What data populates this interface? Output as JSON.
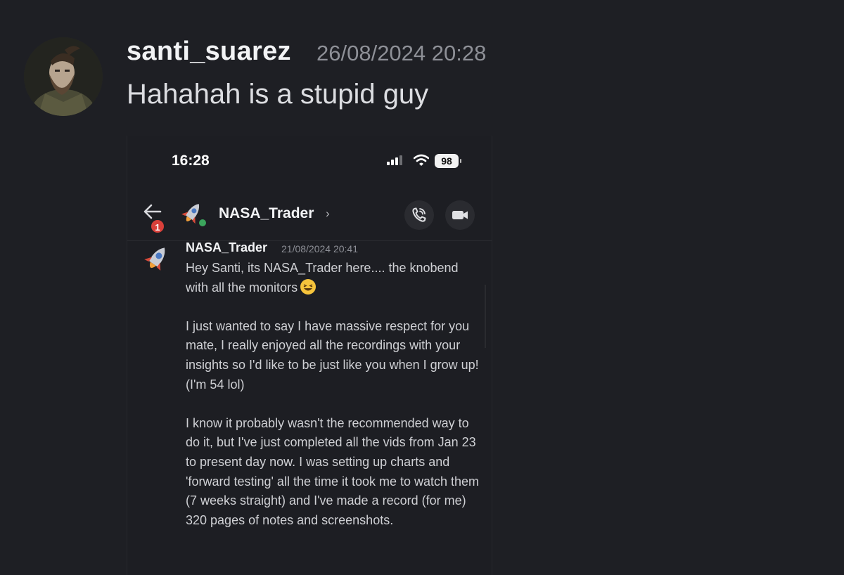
{
  "message": {
    "author": "santi_suarez",
    "timestamp": "26/08/2024 20:28",
    "text": "Hahahah is a stupid guy"
  },
  "screenshot": {
    "status_bar": {
      "time": "16:28",
      "battery": "98"
    },
    "header": {
      "notification_count": "1",
      "name": "NASA_Trader",
      "chevron": "›"
    },
    "dm": {
      "author": "NASA_Trader",
      "timestamp": "21/08/2024 20:41",
      "paragraphs": [
        "Hey Santi, its NASA_Trader here.... the knobend with all the monitors",
        "I just wanted to say I have massive respect for you mate, I really enjoyed all the recordings with your insights so I'd like to be just like you when I grow up! (I'm 54 lol)",
        "I know it probably wasn't the recommended way to do it, but I've just completed all the vids from Jan 23 to present day now. I was setting up charts and 'forward testing'  all the time it took me to watch them (7 weeks straight) and I've made a record (for me) 320 pages of notes and screenshots."
      ]
    },
    "icons": {
      "back": "arrow-left-icon",
      "call": "phone-call-icon",
      "video": "video-camera-icon",
      "emoji": "laughing-emoji"
    }
  },
  "colors": {
    "background": "#1e1f24",
    "online": "#3ba55c",
    "badge": "#d9403a"
  }
}
